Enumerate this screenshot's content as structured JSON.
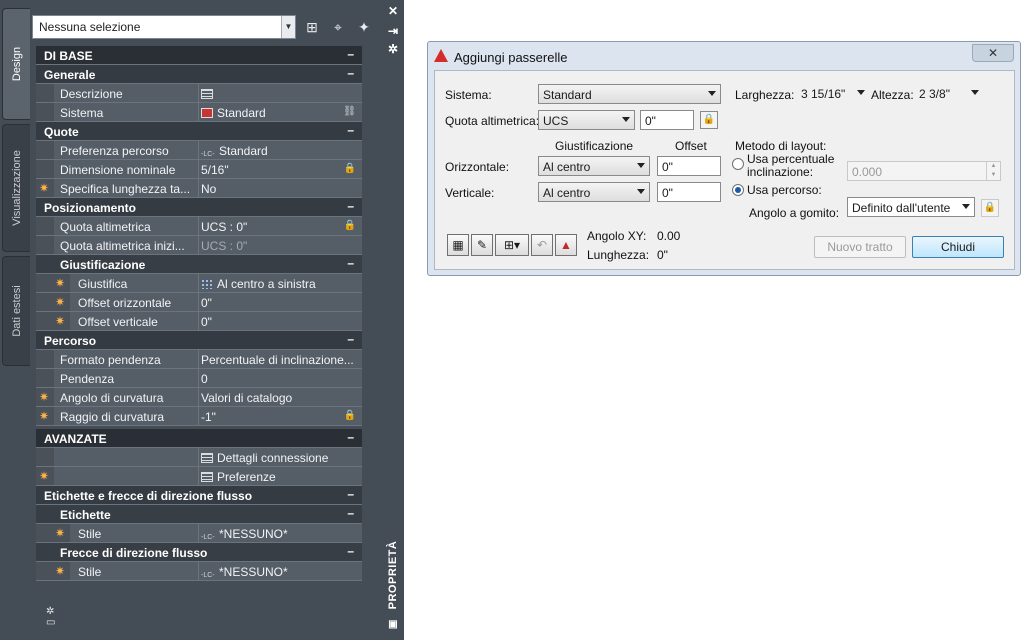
{
  "palette": {
    "selection": "Nessuna selezione",
    "tabs": [
      "Design",
      "Visualizzazione",
      "Dati estesi"
    ],
    "title": "PROPRIETÀ",
    "rows": [
      {
        "kind": "sec",
        "label": "DI BASE",
        "toggle": "–"
      },
      {
        "kind": "sub1",
        "label": "Generale",
        "toggle": "–"
      },
      {
        "kind": "prop",
        "name": "Descrizione",
        "value": "",
        "icon": "tbl"
      },
      {
        "kind": "prop",
        "name": "Sistema",
        "value": "Standard",
        "icon": "red",
        "extra": "⛓"
      },
      {
        "kind": "sub1",
        "label": "Quote",
        "toggle": "–"
      },
      {
        "kind": "prop",
        "name": "Preferenza percorso",
        "value": "Standard",
        "icon": "lc"
      },
      {
        "kind": "prop",
        "name": "Dimensione nominale",
        "value": "5/16\"",
        "lock": true
      },
      {
        "kind": "prop",
        "name": "Specifica lunghezza ta...",
        "value": "No",
        "sun": true
      },
      {
        "kind": "sub1",
        "label": "Posizionamento",
        "toggle": "–"
      },
      {
        "kind": "prop",
        "name": "Quota altimetrica",
        "value": "UCS : 0\"",
        "lock": true
      },
      {
        "kind": "prop",
        "name": "Quota altimetrica inizi...",
        "value": "UCS : 0\"",
        "dim": true
      },
      {
        "kind": "sub2",
        "label": "Giustificazione",
        "toggle": "–"
      },
      {
        "kind": "prop",
        "deep": true,
        "name": "Giustifica",
        "value": "Al centro a sinistra",
        "icon": "grid9",
        "sun": true
      },
      {
        "kind": "prop",
        "deep": true,
        "name": "Offset orizzontale",
        "value": "0\"",
        "sun": true
      },
      {
        "kind": "prop",
        "deep": true,
        "name": "Offset verticale",
        "value": "0\"",
        "sun": true
      },
      {
        "kind": "sub1",
        "label": "Percorso",
        "toggle": "–"
      },
      {
        "kind": "prop",
        "name": "Formato pendenza",
        "value": "Percentuale di inclinazione..."
      },
      {
        "kind": "prop",
        "name": "Pendenza",
        "value": "0"
      },
      {
        "kind": "prop",
        "name": "Angolo di curvatura",
        "value": "Valori di catalogo",
        "sun": true
      },
      {
        "kind": "prop",
        "name": "Raggio di curvatura",
        "value": "-1\"",
        "sun": true,
        "lock": true
      },
      {
        "kind": "sec",
        "label": "AVANZATE",
        "toggle": "–"
      },
      {
        "kind": "prop",
        "name": "",
        "value": "Dettagli connessione",
        "icon": "tbl"
      },
      {
        "kind": "prop",
        "name": "",
        "value": "Preferenze",
        "icon": "tbl",
        "sun": true
      },
      {
        "kind": "sub1",
        "label": "Etichette e frecce di direzione flusso",
        "toggle": "–"
      },
      {
        "kind": "sub2",
        "label": "Etichette",
        "toggle": "–"
      },
      {
        "kind": "prop",
        "deep": true,
        "name": "Stile",
        "value": "*NESSUNO*",
        "icon": "lc",
        "sun": true
      },
      {
        "kind": "sub2",
        "label": "Frecce di direzione flusso",
        "toggle": "–"
      },
      {
        "kind": "prop",
        "deep": true,
        "name": "Stile",
        "value": "*NESSUNO*",
        "icon": "lc",
        "sun": true
      }
    ]
  },
  "dialog": {
    "title": "Aggiungi passerelle",
    "sistema_label": "Sistema:",
    "sistema_value": "Standard",
    "quota_label": "Quota altimetrica:",
    "quota_combo": "UCS",
    "quota_value": "0\"",
    "larghezza_label": "Larghezza:",
    "larghezza_value": "3 15/16\"",
    "altezza_label": "Altezza:",
    "altezza_value": "2 3/8\"",
    "giust_header": "Giustificazione",
    "offset_header": "Offset",
    "orizzontale_label": "Orizzontale:",
    "orizzontale_value": "Al centro",
    "orizzontale_offset": "0\"",
    "verticale_label": "Verticale:",
    "verticale_value": "Al centro",
    "verticale_offset": "0\"",
    "metodo_label": "Metodo di layout:",
    "radio1_line1": "Usa percentuale",
    "radio1_line2": "inclinazione:",
    "radio1_value": "0.000",
    "radio2_label": "Usa percorso:",
    "angolo_gomito_label": "Angolo a gomito:",
    "angolo_gomito_value": "Definito dall'utente",
    "angolo_xy_label": "Angolo XY:",
    "angolo_xy_value": "0.00",
    "lunghezza_label": "Lunghezza:",
    "lunghezza_value": "0\"",
    "nuovo_tratto": "Nuovo tratto",
    "chiudi": "Chiudi"
  }
}
